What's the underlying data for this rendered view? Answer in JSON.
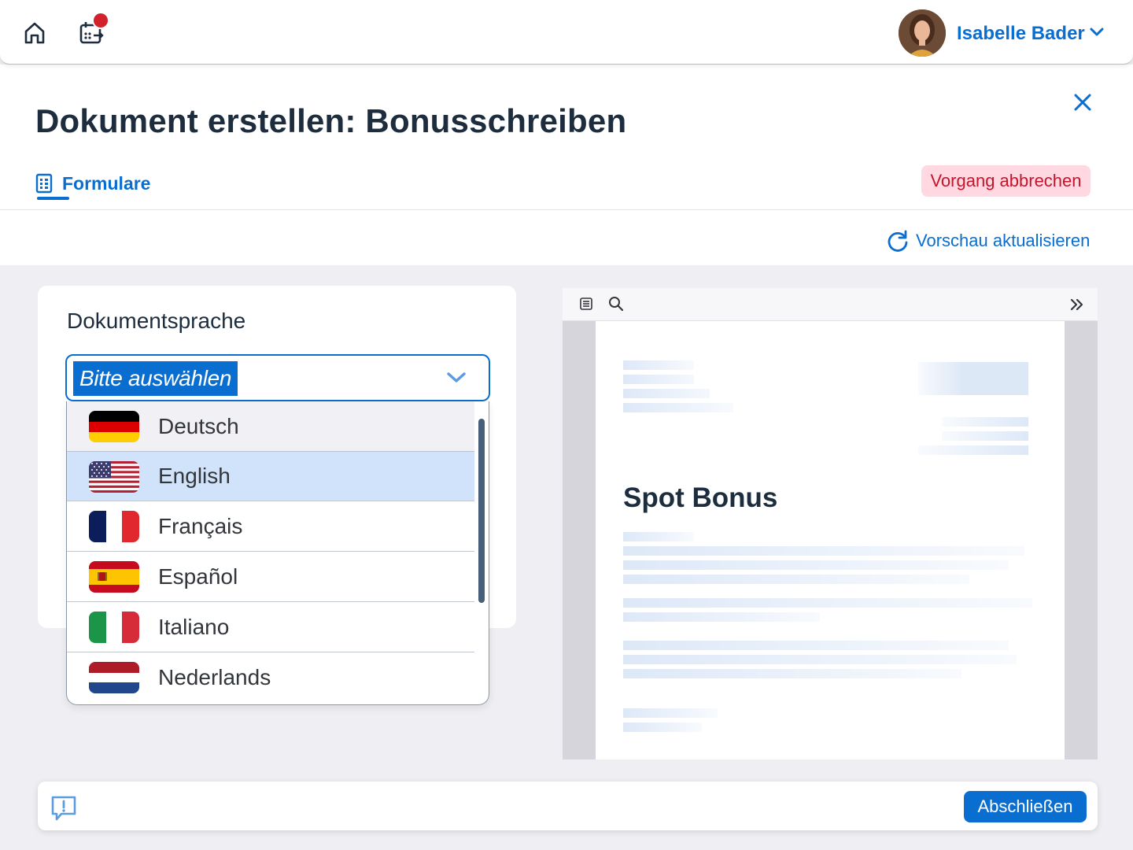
{
  "shell": {
    "user_name": "Isabelle Bader",
    "notification": true
  },
  "header": {
    "title": "Dokument erstellen: Bonusschreiben",
    "tab_label": "Formulare",
    "cancel_label": "Vorgang abbrechen",
    "refresh_label": "Vorschau aktualisieren"
  },
  "form": {
    "language_label": "Dokumentsprache",
    "select_value": "Bitte auswählen",
    "options": [
      {
        "label": "Deutsch",
        "flag": "de-flag"
      },
      {
        "label": "English",
        "flag": "us-flag",
        "selected": true
      },
      {
        "label": "Français",
        "flag": "fr-flag"
      },
      {
        "label": "Español",
        "flag": "es-flag"
      },
      {
        "label": "Italiano",
        "flag": "it-flag"
      },
      {
        "label": "Nederlands",
        "flag": "nl-flag"
      }
    ]
  },
  "preview": {
    "heading": "Spot Bonus"
  },
  "footer": {
    "finish_label": "Abschließen"
  },
  "colors": {
    "accent": "#0a6ed1",
    "danger": "#c4162b",
    "danger_bg": "#ffd8e1",
    "selection": "#d1e3fa"
  }
}
